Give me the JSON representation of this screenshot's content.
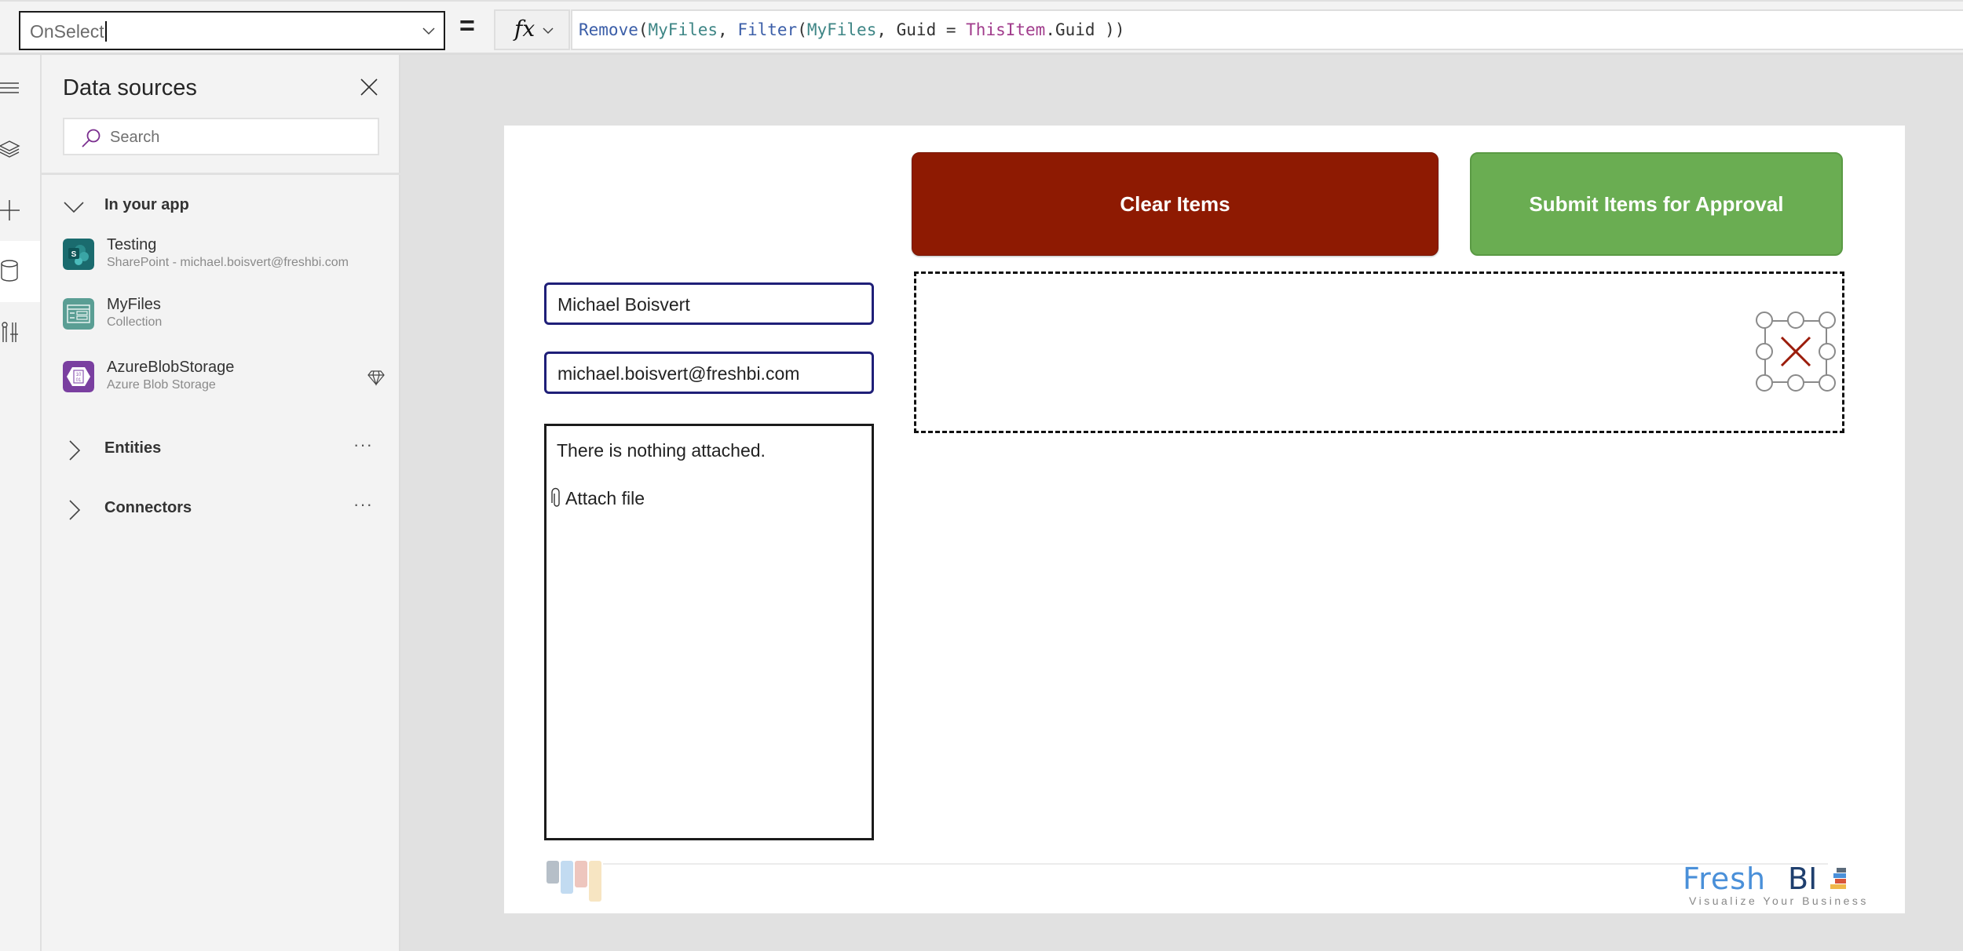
{
  "formula_bar": {
    "property": "OnSelect",
    "equals": "=",
    "fx_label": "fx",
    "formula_tokens": [
      {
        "text": "Remove",
        "kind": "fn"
      },
      {
        "text": "(",
        "kind": "plain"
      },
      {
        "text": "MyFiles",
        "kind": "coll"
      },
      {
        "text": ", ",
        "kind": "plain"
      },
      {
        "text": "Filter",
        "kind": "fn"
      },
      {
        "text": "(",
        "kind": "plain"
      },
      {
        "text": "MyFiles",
        "kind": "coll"
      },
      {
        "text": ", Guid = ",
        "kind": "plain"
      },
      {
        "text": "ThisItem",
        "kind": "kw"
      },
      {
        "text": ".Guid ))",
        "kind": "plain"
      }
    ]
  },
  "rail": {
    "items": [
      {
        "icon": "hamburger-menu-icon"
      },
      {
        "icon": "layers-icon"
      },
      {
        "icon": "plus-icon"
      },
      {
        "icon": "database-icon",
        "selected": true
      },
      {
        "icon": "tools-icon"
      }
    ]
  },
  "data_panel": {
    "title": "Data sources",
    "search_placeholder": "Search",
    "in_app_section": "In your app",
    "sources": [
      {
        "name": "Testing",
        "subtitle": "SharePoint - michael.boisvert@freshbi.com",
        "icon": "sharepoint-icon",
        "color": "#03787c"
      },
      {
        "name": "MyFiles",
        "subtitle": "Collection",
        "icon": "collection-icon",
        "color": "#5a9e94"
      },
      {
        "name": "AzureBlobStorage",
        "subtitle": "Azure Blob Storage",
        "icon": "azure-blob-icon",
        "color": "#7a3fa0",
        "premium": true
      }
    ],
    "sections": [
      {
        "label": "Entities",
        "more": "···"
      },
      {
        "label": "Connectors",
        "more": "···"
      }
    ]
  },
  "canvas": {
    "clear_button": "Clear Items",
    "submit_button": "Submit Items for Approval",
    "name_value": "Michael Boisvert",
    "email_value": "michael.boisvert@freshbi.com",
    "attachments_empty": "There is nothing attached.",
    "attach_label": "Attach file",
    "colors": {
      "clear": "#8e1a02",
      "submit": "#6aad52",
      "delete_icon": "#9b1c0b"
    },
    "logo": {
      "brand_1": "Fresh",
      "brand_2": "BI",
      "tagline": "Visualize Your Business"
    }
  }
}
